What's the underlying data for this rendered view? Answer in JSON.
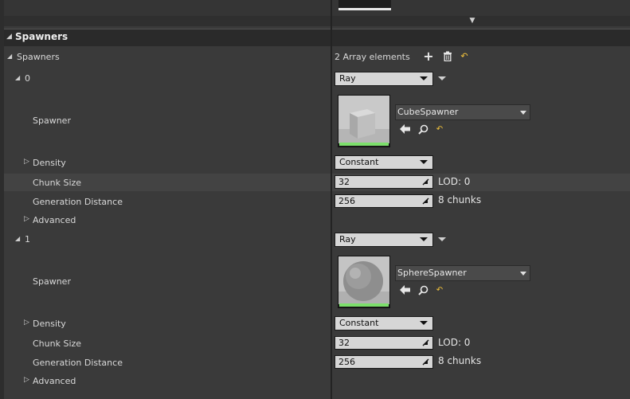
{
  "category": {
    "title": "Spawners"
  },
  "array": {
    "label": "Spawners",
    "count_text": "2 Array elements"
  },
  "elements": [
    {
      "index": "0",
      "type_value": "Ray",
      "spawner_label": "Spawner",
      "asset_name": "CubeSpawner",
      "density_label": "Density",
      "density_value": "Constant",
      "chunk_size_label": "Chunk Size",
      "chunk_size_value": "32",
      "lod_text": "LOD: 0",
      "gen_dist_label": "Generation Distance",
      "gen_dist_value": "256",
      "chunks_text": "8 chunks",
      "advanced_label": "Advanced"
    },
    {
      "index": "1",
      "type_value": "Ray",
      "spawner_label": "Spawner",
      "asset_name": "SphereSpawner",
      "density_label": "Density",
      "density_value": "Constant",
      "chunk_size_label": "Chunk Size",
      "chunk_size_value": "32",
      "lod_text": "LOD: 0",
      "gen_dist_label": "Generation Distance",
      "gen_dist_value": "256",
      "chunks_text": "8 chunks",
      "advanced_label": "Advanced"
    }
  ],
  "icons": {
    "add": "plus-icon",
    "delete": "trash-icon",
    "reset": "reset-arrow-icon",
    "use_selected": "arrow-left-icon",
    "browse": "magnifier-icon"
  },
  "colors": {
    "thumb_bar": "#7cdf6b",
    "reset_icon": "#f2c33c"
  }
}
